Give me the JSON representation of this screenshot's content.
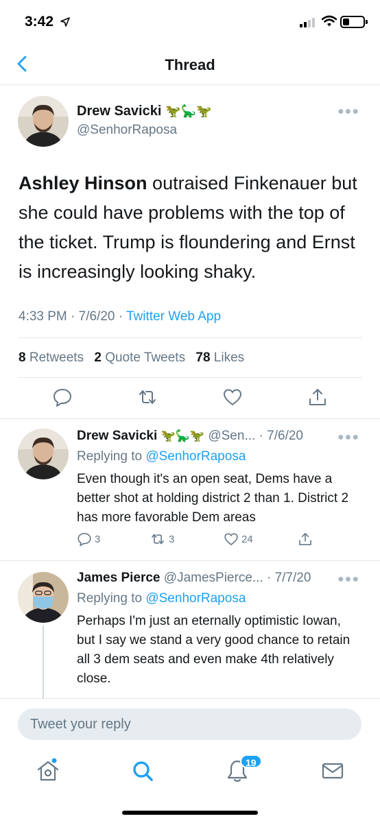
{
  "status_bar": {
    "time": "3:42"
  },
  "header": {
    "title": "Thread"
  },
  "main_tweet": {
    "name": "Drew Savicki",
    "emoji": "🦖🦕🦖",
    "handle": "@SenhorRaposa",
    "text_bold": "Ashley Hinson",
    "text_rest": " outraised Finkenauer but she could have problems with the top of the ticket. Trump is floundering and Ernst is increasingly looking shaky.",
    "time": "4:33 PM · 7/6/20 · ",
    "source": "Twitter Web App",
    "retweets_count": "8",
    "retweets_label": "Retweets",
    "quotes_count": "2",
    "quotes_label": "Quote Tweets",
    "likes_count": "78",
    "likes_label": "Likes"
  },
  "replies": [
    {
      "name": "Drew Savicki",
      "emoji": "🦖🦕🦖",
      "handle": "@Sen...",
      "date": " · 7/6/20",
      "replying_prefix": "Replying to ",
      "replying_to": "@SenhorRaposa",
      "text": "Even though it's an open seat, Dems have a better shot at holding district 2 than 1. District 2 has more favorable Dem areas",
      "reply_count": "3",
      "retweet_count": "3",
      "like_count": "24"
    },
    {
      "name": "James Pierce",
      "handle": "@JamesPierce...",
      "date": " · 7/7/20",
      "replying_prefix": "Replying to ",
      "replying_to": "@SenhorRaposa",
      "text": "Perhaps I'm just an eternally optimistic Iowan, but I say we stand a very good chance to retain all 3 dem seats and even make 4th relatively close."
    }
  ],
  "composer": {
    "placeholder": "Tweet your reply"
  },
  "tabbar": {
    "notifications_badge": "19"
  },
  "colors": {
    "accent": "#1da1f2",
    "secondary_text": "#657786",
    "divider": "#e1e8ed"
  },
  "icons": [
    "back-chevron-icon",
    "more-icon",
    "reply-icon",
    "retweet-icon",
    "like-icon",
    "share-icon",
    "home-icon",
    "search-icon",
    "notifications-icon",
    "messages-icon"
  ]
}
